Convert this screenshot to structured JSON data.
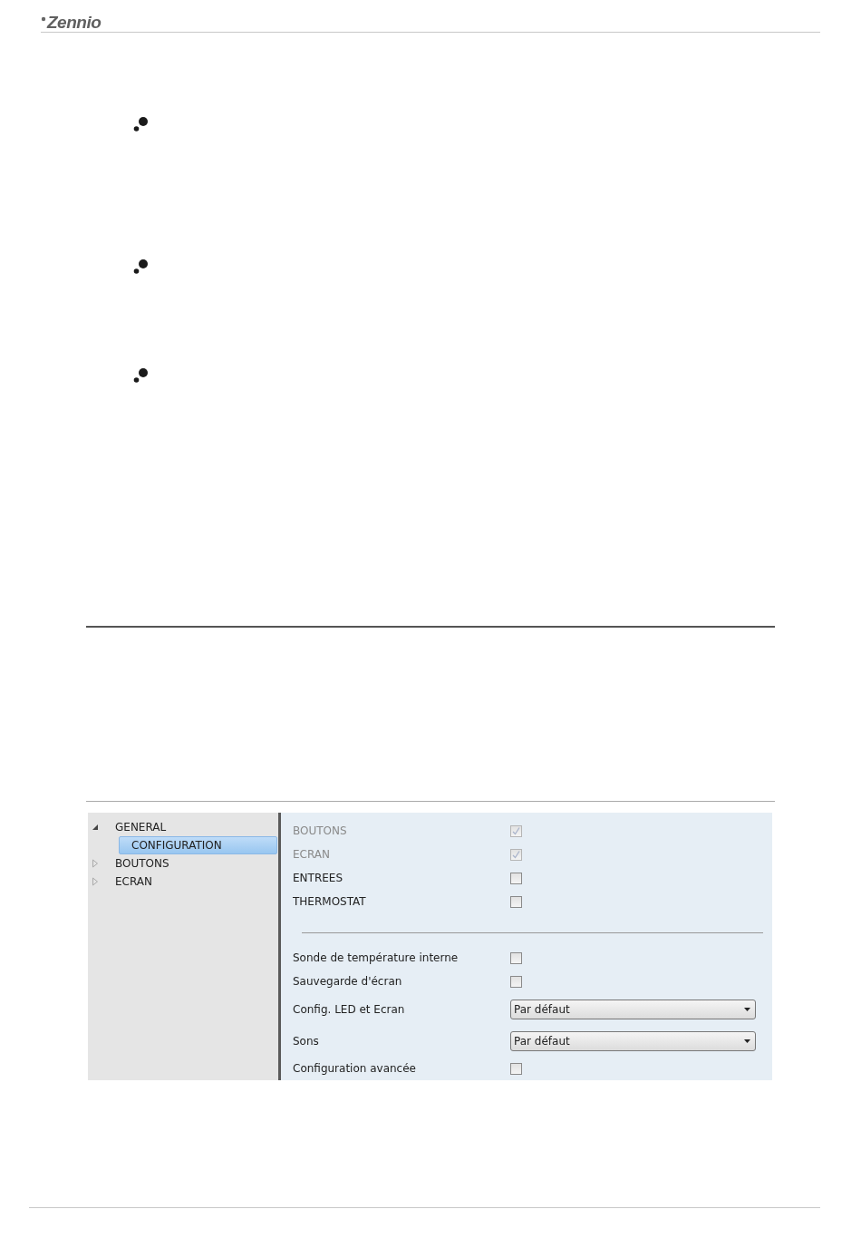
{
  "header": {
    "logo": "Zennio"
  },
  "bullets": [
    {
      "kind": "dots"
    },
    {
      "kind": "dots"
    },
    {
      "kind": "dots"
    }
  ],
  "screenshot": {
    "tree": [
      {
        "label": "GENERAL",
        "expanded": true,
        "selected": false,
        "children": [
          {
            "label": "CONFIGURATION",
            "selected": true
          }
        ]
      },
      {
        "label": "BOUTONS",
        "expanded": false,
        "selected": false
      },
      {
        "label": "ECRAN",
        "expanded": false,
        "selected": false
      }
    ],
    "params": [
      {
        "kind": "checkbox",
        "label": "BOUTONS",
        "checked": true,
        "disabled": true
      },
      {
        "kind": "checkbox",
        "label": "ECRAN",
        "checked": true,
        "disabled": true
      },
      {
        "kind": "checkbox",
        "label": "ENTREES",
        "checked": false,
        "disabled": false
      },
      {
        "kind": "checkbox",
        "label": "THERMOSTAT",
        "checked": false,
        "disabled": false
      },
      {
        "kind": "separator"
      },
      {
        "kind": "checkbox",
        "label": "Sonde de température interne",
        "checked": false,
        "disabled": false
      },
      {
        "kind": "checkbox",
        "label": "Sauvegarde d'écran",
        "checked": false,
        "disabled": false
      },
      {
        "kind": "select",
        "label": "Config. LED et Ecran",
        "value": "Par défaut"
      },
      {
        "kind": "select",
        "label": "Sons",
        "value": "Par défaut"
      },
      {
        "kind": "checkbox",
        "label": "Configuration avancée",
        "checked": false,
        "disabled": false
      }
    ]
  }
}
